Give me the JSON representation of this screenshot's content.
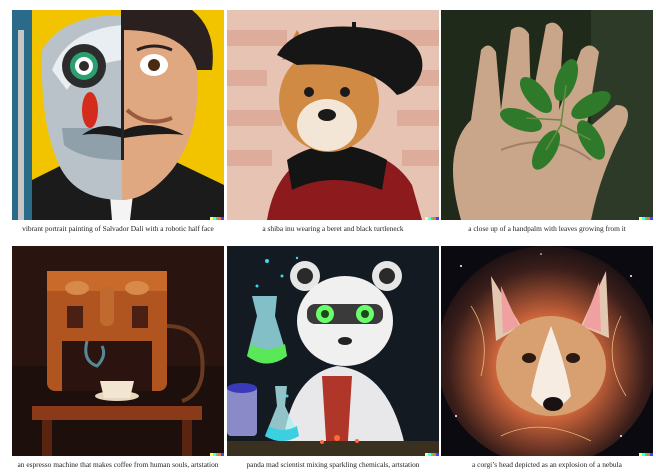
{
  "captions": [
    "vibrant portrait painting of Salvador Dalí with a robotic half face",
    "a shiba inu wearing a beret and black turtleneck",
    "a close up of a handpalm with leaves growing from it",
    "an espresso machine that makes coffee from human souls, artstation",
    "panda mad scientist mixing sparkling chemicals, artstation",
    "a corgi’s head depicted as an explosion of a nebula"
  ],
  "images": [
    "portrait-painting-image",
    "shiba-inu-photo",
    "hand-with-leaves-photo",
    "espresso-machine-art",
    "panda-scientist-art",
    "corgi-nebula-art"
  ],
  "colors": {
    "watermark": [
      "#ffff66",
      "#42ffff",
      "#51da4c",
      "#ff6e3c",
      "#3c46ff"
    ],
    "caption_text": "#222222",
    "background": "#ffffff"
  }
}
